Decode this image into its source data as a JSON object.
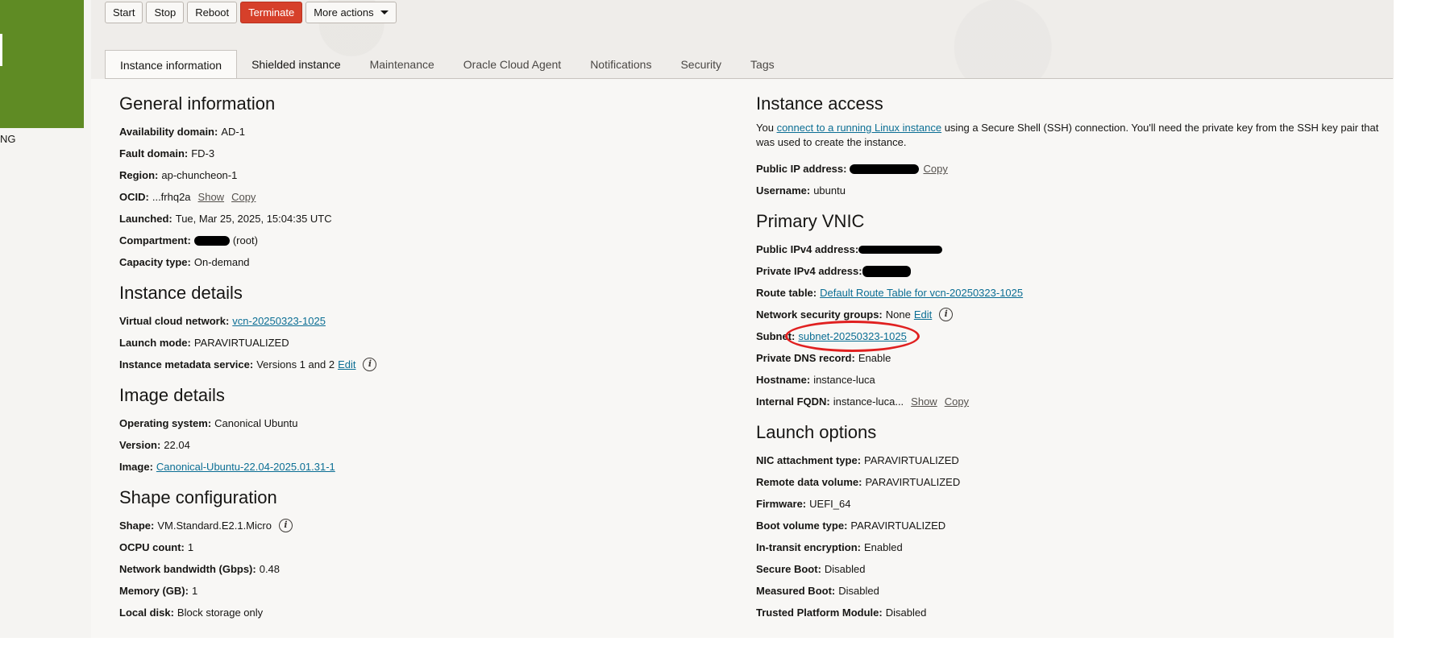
{
  "sidebar": {
    "status_text": "NG"
  },
  "toolbar": {
    "start": "Start",
    "stop": "Stop",
    "reboot": "Reboot",
    "terminate": "Terminate",
    "more_actions": "More actions",
    "colors": {
      "terminate_bg": "#d6402a",
      "tile": "#5f8b24"
    }
  },
  "tabs": [
    "Instance information",
    "Shielded instance",
    "Maintenance",
    "Oracle Cloud Agent",
    "Notifications",
    "Security",
    "Tags"
  ],
  "general": {
    "title": "General information",
    "availability_domain": {
      "label": "Availability domain:",
      "value": "AD-1"
    },
    "fault_domain": {
      "label": "Fault domain:",
      "value": "FD-3"
    },
    "region": {
      "label": "Region:",
      "value": "ap-chuncheon-1"
    },
    "ocid": {
      "label": "OCID:",
      "value": "...frhq2a",
      "show": "Show",
      "copy": "Copy"
    },
    "launched": {
      "label": "Launched:",
      "value": "Tue, Mar 25, 2025, 15:04:35 UTC"
    },
    "compartment": {
      "label": "Compartment:",
      "value": "(root)"
    },
    "capacity_type": {
      "label": "Capacity type:",
      "value": "On-demand"
    }
  },
  "instance_details": {
    "title": "Instance details",
    "vcn": {
      "label": "Virtual cloud network:",
      "value": "vcn-20250323-1025"
    },
    "launch_mode": {
      "label": "Launch mode:",
      "value": "PARAVIRTUALIZED"
    },
    "metadata_service": {
      "label": "Instance metadata service:",
      "value": "Versions 1 and 2",
      "edit": "Edit"
    }
  },
  "image_details": {
    "title": "Image details",
    "os": {
      "label": "Operating system:",
      "value": "Canonical Ubuntu"
    },
    "version": {
      "label": "Version:",
      "value": "22.04"
    },
    "image": {
      "label": "Image:",
      "value": "Canonical-Ubuntu-22.04-2025.01.31-1"
    }
  },
  "shape": {
    "title": "Shape configuration",
    "shape": {
      "label": "Shape:",
      "value": "VM.Standard.E2.1.Micro"
    },
    "ocpu": {
      "label": "OCPU count:",
      "value": "1"
    },
    "bandwidth": {
      "label": "Network bandwidth (Gbps):",
      "value": "0.48"
    },
    "memory": {
      "label": "Memory (GB):",
      "value": "1"
    },
    "local_disk": {
      "label": "Local disk:",
      "value": "Block storage only"
    }
  },
  "access": {
    "title": "Instance access",
    "intro_before": "You ",
    "intro_link": "connect to a running Linux instance",
    "intro_after": " using a Secure Shell (SSH) connection. You'll need the private key from the SSH key pair that was used to create the instance.",
    "public_ip": {
      "label": "Public IP address:",
      "copy": "Copy"
    },
    "username": {
      "label": "Username:",
      "value": "ubuntu"
    }
  },
  "vnic": {
    "title": "Primary VNIC",
    "public_ipv4": {
      "label": "Public IPv4 address:"
    },
    "private_ipv4": {
      "label": "Private IPv4 address:"
    },
    "route_table": {
      "label": "Route table:",
      "value": "Default Route Table for vcn-20250323-1025"
    },
    "nsg": {
      "label": "Network security groups:",
      "value": "None",
      "edit": "Edit"
    },
    "subnet": {
      "label": "Subnet:",
      "value": "subnet-20250323-1025",
      "highlight_color": "#e02020"
    },
    "private_dns": {
      "label": "Private DNS record:",
      "value": "Enable"
    },
    "hostname": {
      "label": "Hostname:",
      "value": "instance-luca"
    },
    "fqdn": {
      "label": "Internal FQDN:",
      "value": "instance-luca...",
      "show": "Show",
      "copy": "Copy"
    }
  },
  "launch": {
    "title": "Launch options",
    "nic": {
      "label": "NIC attachment type:",
      "value": "PARAVIRTUALIZED"
    },
    "remote_volume": {
      "label": "Remote data volume:",
      "value": "PARAVIRTUALIZED"
    },
    "firmware": {
      "label": "Firmware:",
      "value": "UEFI_64"
    },
    "boot_volume": {
      "label": "Boot volume type:",
      "value": "PARAVIRTUALIZED"
    },
    "in_transit": {
      "label": "In-transit encryption:",
      "value": "Enabled"
    },
    "secure_boot": {
      "label": "Secure Boot:",
      "value": "Disabled"
    },
    "measured_boot": {
      "label": "Measured Boot:",
      "value": "Disabled"
    },
    "tpm": {
      "label": "Trusted Platform Module:",
      "value": "Disabled"
    }
  }
}
